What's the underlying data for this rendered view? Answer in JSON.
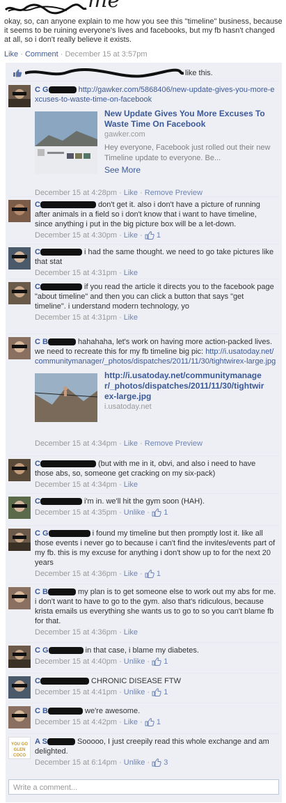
{
  "post": {
    "author_handwritten": "me",
    "text": "okay, so, can anyone explain to me how you see this \"timeline\" business, because it seems to be ruining everyone's lives and facebooks, but my fb hasn't changed at all, so i don't really believe it exists.",
    "actions": [
      "Like",
      "Comment"
    ],
    "timestamp": "December 15 at 3:57pm"
  },
  "likes": {
    "text": "like this."
  },
  "comments": [
    {
      "name": "C G",
      "text": "http://gawker.com/5868406/new-update-gives-you-more-excuses-to-waste-time-on-facebook",
      "preview": {
        "title": "New Update Gives You More Excuses To Waste Time On Facebook",
        "domain": "gawker.com",
        "description": "Hey everyone, Facebook just rolled out their new Timeline update to everyone. Be...",
        "more": "See More"
      },
      "timestamp": "December 15 at 4:28pm",
      "actions": [
        "Like",
        "Remove Preview"
      ]
    },
    {
      "name": "C",
      "text": "don't get it. also i don't have a picture of running after animals in a field so i don't know that i want to have timeline, since anything i put in the big picture box will be a let-down.",
      "timestamp": "December 15 at 4:30pm",
      "actions": [
        "Like"
      ],
      "likes": "1"
    },
    {
      "name": "C",
      "text": "i had the same thought. we need to go take pictures like that stat",
      "timestamp": "December 15 at 4:31pm",
      "actions": [
        "Like"
      ]
    },
    {
      "name": "C",
      "text": "if you read the article it directs you to the facebook page \"about timeline\" and then you can click a button that says \"get timeline\". i understand modern technology, yo",
      "timestamp": "December 15 at 4:31pm",
      "actions": [
        "Like"
      ]
    },
    {
      "name": "C B",
      "text": "hahahaha, let's work on having more action-packed lives. we need to recreate this for my fb timeline big pic:",
      "link": "http://i.usatoday.net/communitymanager/_photos/dispatches/2011/11/30/tightwirex-large.jpg",
      "preview": {
        "title": "http://i.usatoday.net/communitymanager/_photos/dispatches/2011/11/30/tightwirex-large.jpg",
        "domain": "i.usatoday.net"
      },
      "timestamp": "December 15 at 4:34pm",
      "actions": [
        "Like",
        "Remove Preview"
      ]
    },
    {
      "name": "C",
      "text": "(but with me in it, obvi, and also i need to have those abs, so, someone get cracking on my six-pack)",
      "timestamp": "December 15 at 4:34pm",
      "actions": [
        "Like"
      ]
    },
    {
      "name": "C",
      "text": "i'm in. we'll hit the gym soon (HAH).",
      "timestamp": "December 15 at 4:35pm",
      "actions": [
        "Unlike"
      ],
      "likes": "1"
    },
    {
      "name": "C G",
      "text": "i found my timeline but then promptly lost it. like all those events i never go to because i can't find the invites/events part of my fb. this is my excuse for anything i don't show up to for the next 20 years",
      "timestamp": "December 15 at 4:36pm",
      "actions": [
        "Like"
      ],
      "likes": "1"
    },
    {
      "name": "C B",
      "text": "my plan is to get someone else to work out my abs for me. i don't want to have to go to the gym. also that's ridiculous, because krista emails us everything she wants us to go to so you can't blame fb for that.",
      "timestamp": "December 15 at 4:36pm",
      "actions": [
        "Like"
      ]
    },
    {
      "name": "C G",
      "text": "in that case, i blame my diabetes.",
      "timestamp": "December 15 at 4:40pm",
      "actions": [
        "Unlike"
      ],
      "likes": "1"
    },
    {
      "name": "C",
      "text": "CHRONIC DISEASE FTW",
      "timestamp": "December 15 at 4:41pm",
      "actions": [
        "Unlike"
      ],
      "likes": "1"
    },
    {
      "name": "C B",
      "text": "we're awesome.",
      "timestamp": "December 15 at 4:42pm",
      "actions": [
        "Like"
      ],
      "likes": "1"
    },
    {
      "name": "A S",
      "avatar_text": "YOU GO GLEN COCO",
      "text": "Sooooo, I just creepily read this whole exchange and am delighted.",
      "timestamp": "December 15 at 6:14pm",
      "actions": [
        "Unlike"
      ],
      "likes": "3"
    }
  ],
  "write_comment": {
    "placeholder": "Write a comment..."
  },
  "colors": {
    "link": "#3b5998",
    "meta": "#999999",
    "thread_bg": "#edeff4",
    "border": "#bdc7d8"
  }
}
